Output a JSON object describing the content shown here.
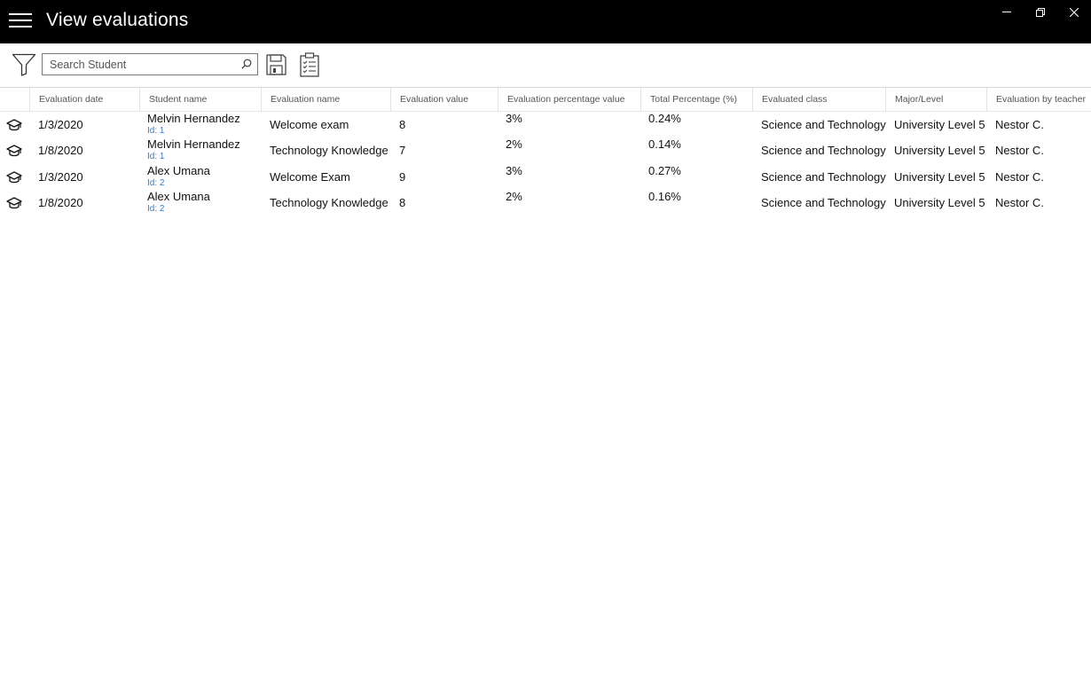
{
  "window": {
    "title": "View evaluations"
  },
  "toolbar": {
    "search_placeholder": "Search Student",
    "search_value": ""
  },
  "table": {
    "columns": [
      "Evaluation date",
      "Student name",
      "Evaluation name",
      "Evaluation value",
      "Evaluation percentage value",
      "Total Percentage (%)",
      "Evaluated class",
      "Major/Level",
      "Evaluation by teacher"
    ],
    "rows": [
      {
        "date": "1/3/2020",
        "student": "Melvin Hernandez",
        "id": "Id: 1",
        "evaluation": "Welcome exam",
        "value": "8",
        "pct": "3%",
        "total": "0.24%",
        "class": "Science and Technology",
        "major": "University Level 5",
        "teacher": "Nestor C."
      },
      {
        "date": "1/8/2020",
        "student": "Melvin Hernandez",
        "id": "Id: 1",
        "evaluation": "Technology Knowledge",
        "value": "7",
        "pct": "2%",
        "total": "0.14%",
        "class": "Science and Technology",
        "major": "University Level 5",
        "teacher": "Nestor C."
      },
      {
        "date": "1/3/2020",
        "student": "Alex Umana",
        "id": "Id: 2",
        "evaluation": "Welcome Exam",
        "value": "9",
        "pct": "3%",
        "total": "0.27%",
        "class": "Science and Technology",
        "major": "University Level 5",
        "teacher": "Nestor C."
      },
      {
        "date": "1/8/2020",
        "student": "Alex Umana",
        "id": "Id: 2",
        "evaluation": "Technology Knowledge",
        "value": "8",
        "pct": "2%",
        "total": "0.16%",
        "class": "Science and Technology",
        "major": "University Level 5",
        "teacher": "Nestor C."
      }
    ],
    "row_icon": "graduation-cap-icon"
  },
  "colors": {
    "titlebar_bg": "#000000",
    "id_link": "#2e7bcf"
  }
}
